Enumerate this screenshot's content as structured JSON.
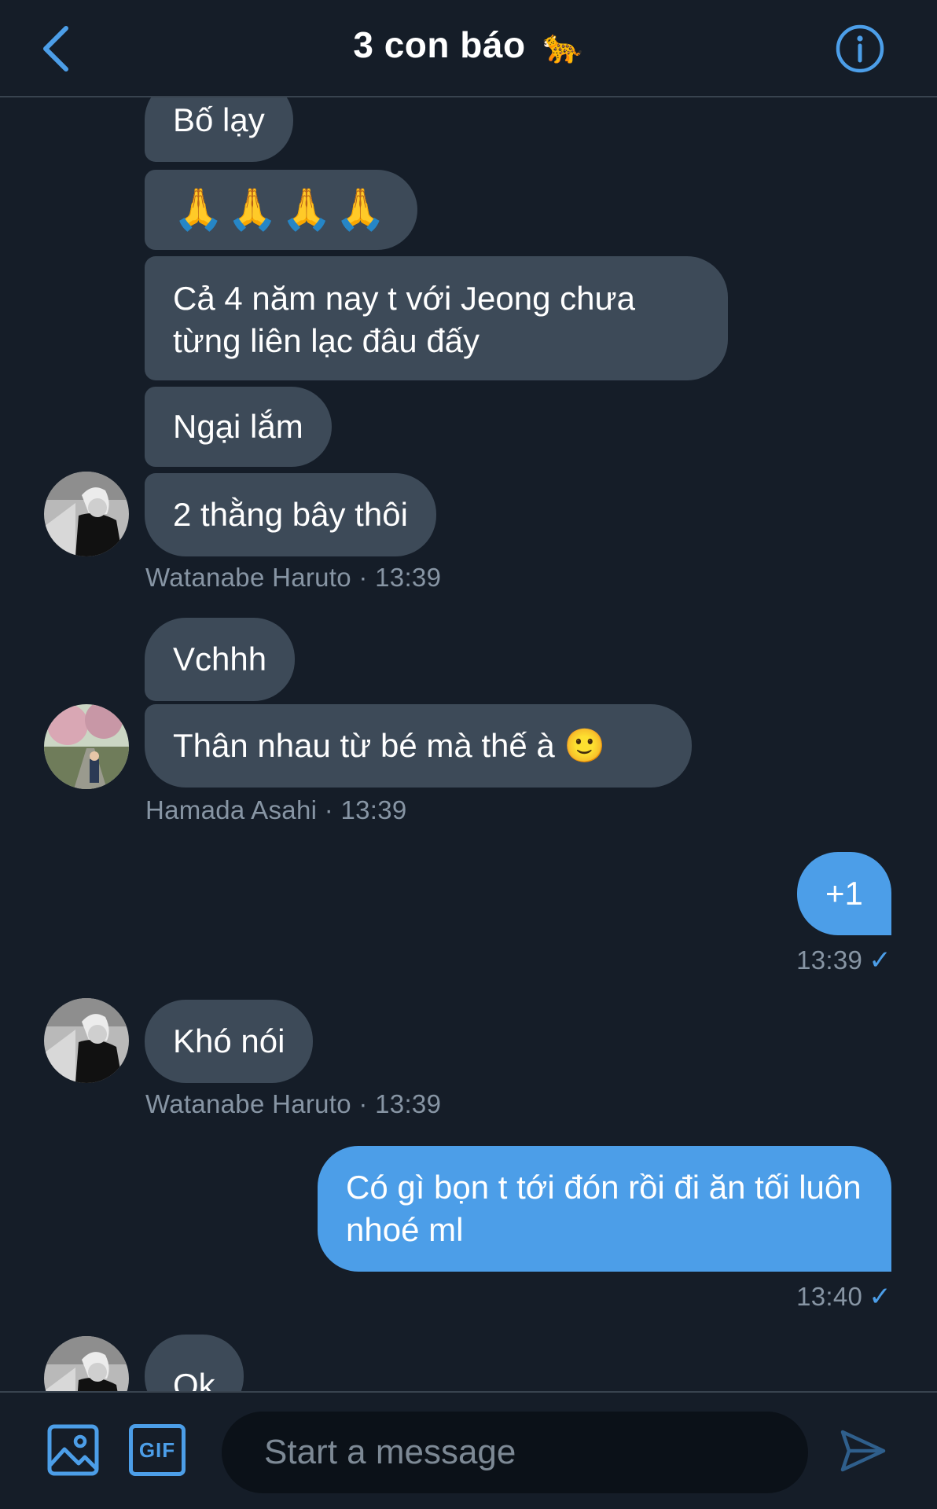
{
  "header": {
    "title": "3 con báo",
    "title_emoji": "🐆"
  },
  "messages": [
    {
      "text": "Bố lạy"
    },
    {
      "text": "🙏🙏🙏🙏"
    },
    {
      "text": "Cả 4 năm nay t với Jeong chưa từng liên lạc đâu đấy"
    },
    {
      "text": "Ngại lắm"
    },
    {
      "text": "2 thằng bây thôi"
    },
    {
      "meta": "Watanabe Haruto · 13:39"
    },
    {
      "text": "Vchhh"
    },
    {
      "text": "Thân nhau từ bé mà thế à 🙂"
    },
    {
      "meta": "Hamada Asahi · 13:39"
    },
    {
      "text": "+1"
    },
    {
      "meta": "13:39"
    },
    {
      "text": "Khó nói"
    },
    {
      "meta": "Watanabe Haruto · 13:39"
    },
    {
      "text": "Có gì bọn t tới đón rồi đi ăn tối luôn nhoé ml"
    },
    {
      "meta": "13:40"
    },
    {
      "text": "Ok"
    }
  ],
  "composer": {
    "placeholder": "Start a message",
    "gif_label": "GIF"
  },
  "colors": {
    "background": "#151d28",
    "incoming_bubble": "#3d4a58",
    "outgoing_bubble": "#4c9ee8",
    "accent": "#4c9ee8"
  },
  "icons": [
    "chevron-left-icon",
    "info-icon",
    "image-icon",
    "gif-icon",
    "send-icon",
    "checkmark-icon"
  ]
}
